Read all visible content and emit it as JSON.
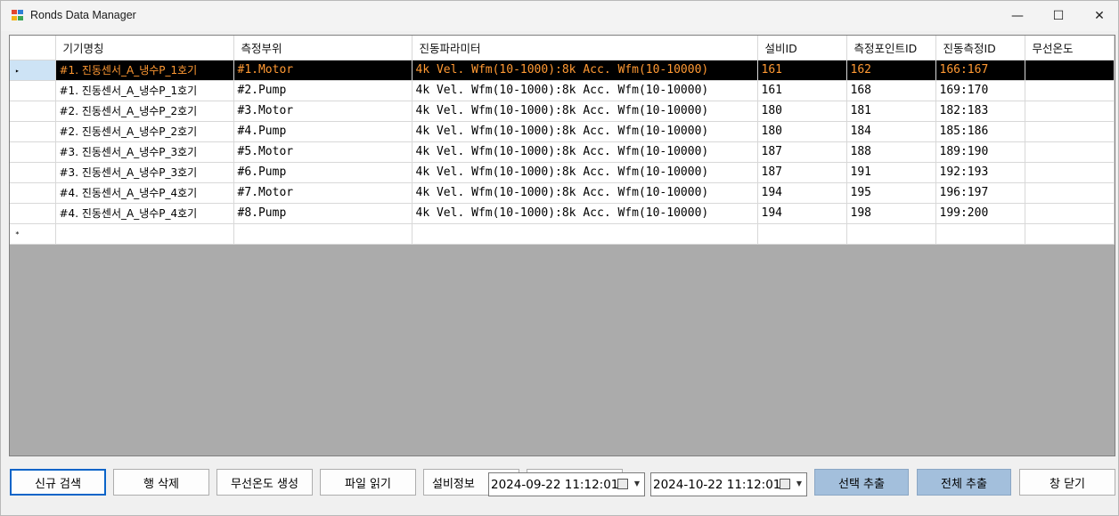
{
  "window": {
    "title": "Ronds Data Manager"
  },
  "titlebar_controls": {
    "minimize": "—",
    "maximize": "☐",
    "close": "✕"
  },
  "grid": {
    "columns": [
      "기기명칭",
      "측정부위",
      "진동파라미터",
      "설비ID",
      "측정포인트ID",
      "진동측정ID",
      "무선온도"
    ],
    "rows": [
      [
        "#1. 진동센서_A_냉수P_1호기",
        "#1.Motor",
        "4k Vel. Wfm(10-1000):8k Acc. Wfm(10-10000)",
        "161",
        "162",
        "166:167",
        ""
      ],
      [
        "#1. 진동센서_A_냉수P_1호기",
        "#2.Pump",
        "4k Vel. Wfm(10-1000):8k Acc. Wfm(10-10000)",
        "161",
        "168",
        "169:170",
        ""
      ],
      [
        "#2. 진동센서_A_냉수P_2호기",
        "#3.Motor",
        "4k Vel. Wfm(10-1000):8k Acc. Wfm(10-10000)",
        "180",
        "181",
        "182:183",
        ""
      ],
      [
        "#2. 진동센서_A_냉수P_2호기",
        "#4.Pump",
        "4k Vel. Wfm(10-1000):8k Acc. Wfm(10-10000)",
        "180",
        "184",
        "185:186",
        ""
      ],
      [
        "#3. 진동센서_A_냉수P_3호기",
        "#5.Motor",
        "4k Vel. Wfm(10-1000):8k Acc. Wfm(10-10000)",
        "187",
        "188",
        "189:190",
        ""
      ],
      [
        "#3. 진동센서_A_냉수P_3호기",
        "#6.Pump",
        "4k Vel. Wfm(10-1000):8k Acc. Wfm(10-10000)",
        "187",
        "191",
        "192:193",
        ""
      ],
      [
        "#4. 진동센서_A_냉수P_4호기",
        "#7.Motor",
        "4k Vel. Wfm(10-1000):8k Acc. Wfm(10-10000)",
        "194",
        "195",
        "196:197",
        ""
      ],
      [
        "#4. 진동센서_A_냉수P_4호기",
        "#8.Pump",
        "4k Vel. Wfm(10-1000):8k Acc. Wfm(10-10000)",
        "194",
        "198",
        "199:200",
        ""
      ]
    ],
    "selected_row": 0,
    "current_row_marker": "▸",
    "new_row_marker": "*"
  },
  "buttons": {
    "new_search": "신규 검색",
    "delete_row": "행 삭제",
    "create_wireless_temp": "무선온도 생성",
    "read_file": "파일 읽기",
    "equipment_info": "설비정보",
    "extract_selected": "선택 추출",
    "extract_all": "전체 추출",
    "close_window": "창 닫기"
  },
  "date_range": {
    "start": "2024-09-22 11:12:01",
    "end": "2024-10-22 11:12:01"
  },
  "colors": {
    "selected_row_bg": "#000000",
    "selected_row_text": "#ff9933",
    "grid_background": "#ababab",
    "extract_button_bg": "#a3bfdc",
    "focus_border": "#0a64c8"
  }
}
